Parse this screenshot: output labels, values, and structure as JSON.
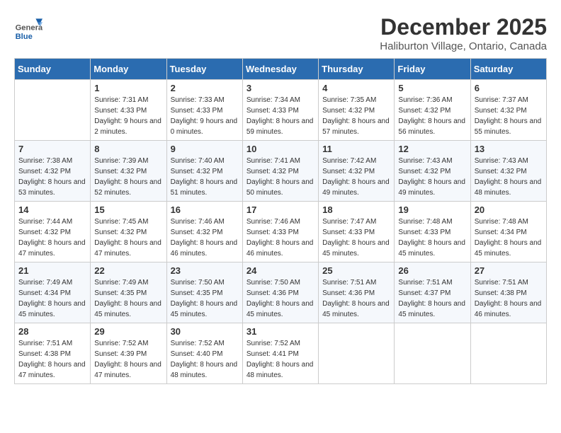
{
  "header": {
    "logo_general": "General",
    "logo_blue": "Blue",
    "month_title": "December 2025",
    "location": "Haliburton Village, Ontario, Canada"
  },
  "weekdays": [
    "Sunday",
    "Monday",
    "Tuesday",
    "Wednesday",
    "Thursday",
    "Friday",
    "Saturday"
  ],
  "weeks": [
    [
      {
        "day": "",
        "sunrise": "",
        "sunset": "",
        "daylight": ""
      },
      {
        "day": "1",
        "sunrise": "Sunrise: 7:31 AM",
        "sunset": "Sunset: 4:33 PM",
        "daylight": "Daylight: 9 hours and 2 minutes."
      },
      {
        "day": "2",
        "sunrise": "Sunrise: 7:33 AM",
        "sunset": "Sunset: 4:33 PM",
        "daylight": "Daylight: 9 hours and 0 minutes."
      },
      {
        "day": "3",
        "sunrise": "Sunrise: 7:34 AM",
        "sunset": "Sunset: 4:33 PM",
        "daylight": "Daylight: 8 hours and 59 minutes."
      },
      {
        "day": "4",
        "sunrise": "Sunrise: 7:35 AM",
        "sunset": "Sunset: 4:32 PM",
        "daylight": "Daylight: 8 hours and 57 minutes."
      },
      {
        "day": "5",
        "sunrise": "Sunrise: 7:36 AM",
        "sunset": "Sunset: 4:32 PM",
        "daylight": "Daylight: 8 hours and 56 minutes."
      },
      {
        "day": "6",
        "sunrise": "Sunrise: 7:37 AM",
        "sunset": "Sunset: 4:32 PM",
        "daylight": "Daylight: 8 hours and 55 minutes."
      }
    ],
    [
      {
        "day": "7",
        "sunrise": "Sunrise: 7:38 AM",
        "sunset": "Sunset: 4:32 PM",
        "daylight": "Daylight: 8 hours and 53 minutes."
      },
      {
        "day": "8",
        "sunrise": "Sunrise: 7:39 AM",
        "sunset": "Sunset: 4:32 PM",
        "daylight": "Daylight: 8 hours and 52 minutes."
      },
      {
        "day": "9",
        "sunrise": "Sunrise: 7:40 AM",
        "sunset": "Sunset: 4:32 PM",
        "daylight": "Daylight: 8 hours and 51 minutes."
      },
      {
        "day": "10",
        "sunrise": "Sunrise: 7:41 AM",
        "sunset": "Sunset: 4:32 PM",
        "daylight": "Daylight: 8 hours and 50 minutes."
      },
      {
        "day": "11",
        "sunrise": "Sunrise: 7:42 AM",
        "sunset": "Sunset: 4:32 PM",
        "daylight": "Daylight: 8 hours and 49 minutes."
      },
      {
        "day": "12",
        "sunrise": "Sunrise: 7:43 AM",
        "sunset": "Sunset: 4:32 PM",
        "daylight": "Daylight: 8 hours and 49 minutes."
      },
      {
        "day": "13",
        "sunrise": "Sunrise: 7:43 AM",
        "sunset": "Sunset: 4:32 PM",
        "daylight": "Daylight: 8 hours and 48 minutes."
      }
    ],
    [
      {
        "day": "14",
        "sunrise": "Sunrise: 7:44 AM",
        "sunset": "Sunset: 4:32 PM",
        "daylight": "Daylight: 8 hours and 47 minutes."
      },
      {
        "day": "15",
        "sunrise": "Sunrise: 7:45 AM",
        "sunset": "Sunset: 4:32 PM",
        "daylight": "Daylight: 8 hours and 47 minutes."
      },
      {
        "day": "16",
        "sunrise": "Sunrise: 7:46 AM",
        "sunset": "Sunset: 4:32 PM",
        "daylight": "Daylight: 8 hours and 46 minutes."
      },
      {
        "day": "17",
        "sunrise": "Sunrise: 7:46 AM",
        "sunset": "Sunset: 4:33 PM",
        "daylight": "Daylight: 8 hours and 46 minutes."
      },
      {
        "day": "18",
        "sunrise": "Sunrise: 7:47 AM",
        "sunset": "Sunset: 4:33 PM",
        "daylight": "Daylight: 8 hours and 45 minutes."
      },
      {
        "day": "19",
        "sunrise": "Sunrise: 7:48 AM",
        "sunset": "Sunset: 4:33 PM",
        "daylight": "Daylight: 8 hours and 45 minutes."
      },
      {
        "day": "20",
        "sunrise": "Sunrise: 7:48 AM",
        "sunset": "Sunset: 4:34 PM",
        "daylight": "Daylight: 8 hours and 45 minutes."
      }
    ],
    [
      {
        "day": "21",
        "sunrise": "Sunrise: 7:49 AM",
        "sunset": "Sunset: 4:34 PM",
        "daylight": "Daylight: 8 hours and 45 minutes."
      },
      {
        "day": "22",
        "sunrise": "Sunrise: 7:49 AM",
        "sunset": "Sunset: 4:35 PM",
        "daylight": "Daylight: 8 hours and 45 minutes."
      },
      {
        "day": "23",
        "sunrise": "Sunrise: 7:50 AM",
        "sunset": "Sunset: 4:35 PM",
        "daylight": "Daylight: 8 hours and 45 minutes."
      },
      {
        "day": "24",
        "sunrise": "Sunrise: 7:50 AM",
        "sunset": "Sunset: 4:36 PM",
        "daylight": "Daylight: 8 hours and 45 minutes."
      },
      {
        "day": "25",
        "sunrise": "Sunrise: 7:51 AM",
        "sunset": "Sunset: 4:36 PM",
        "daylight": "Daylight: 8 hours and 45 minutes."
      },
      {
        "day": "26",
        "sunrise": "Sunrise: 7:51 AM",
        "sunset": "Sunset: 4:37 PM",
        "daylight": "Daylight: 8 hours and 45 minutes."
      },
      {
        "day": "27",
        "sunrise": "Sunrise: 7:51 AM",
        "sunset": "Sunset: 4:38 PM",
        "daylight": "Daylight: 8 hours and 46 minutes."
      }
    ],
    [
      {
        "day": "28",
        "sunrise": "Sunrise: 7:51 AM",
        "sunset": "Sunset: 4:38 PM",
        "daylight": "Daylight: 8 hours and 47 minutes."
      },
      {
        "day": "29",
        "sunrise": "Sunrise: 7:52 AM",
        "sunset": "Sunset: 4:39 PM",
        "daylight": "Daylight: 8 hours and 47 minutes."
      },
      {
        "day": "30",
        "sunrise": "Sunrise: 7:52 AM",
        "sunset": "Sunset: 4:40 PM",
        "daylight": "Daylight: 8 hours and 48 minutes."
      },
      {
        "day": "31",
        "sunrise": "Sunrise: 7:52 AM",
        "sunset": "Sunset: 4:41 PM",
        "daylight": "Daylight: 8 hours and 48 minutes."
      },
      {
        "day": "",
        "sunrise": "",
        "sunset": "",
        "daylight": ""
      },
      {
        "day": "",
        "sunrise": "",
        "sunset": "",
        "daylight": ""
      },
      {
        "day": "",
        "sunrise": "",
        "sunset": "",
        "daylight": ""
      }
    ]
  ]
}
